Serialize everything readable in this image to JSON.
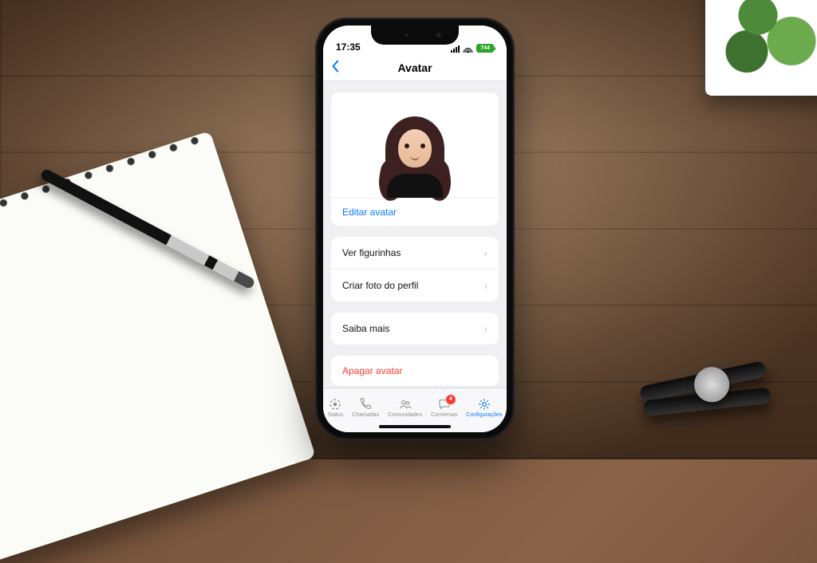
{
  "statusbar": {
    "time": "17:35",
    "battery": "744"
  },
  "header": {
    "title": "Avatar"
  },
  "avatar_card": {
    "edit_link": "Editar avatar"
  },
  "options": {
    "items": [
      {
        "label": "Ver figurinhas"
      },
      {
        "label": "Criar foto do perfil"
      }
    ]
  },
  "info": {
    "label": "Saiba mais"
  },
  "delete": {
    "label": "Apagar avatar"
  },
  "tabs": {
    "items": [
      {
        "label": "Status"
      },
      {
        "label": "Chamadas"
      },
      {
        "label": "Comunidades"
      },
      {
        "label": "Conversas",
        "badge": "4"
      },
      {
        "label": "Configurações"
      }
    ]
  }
}
